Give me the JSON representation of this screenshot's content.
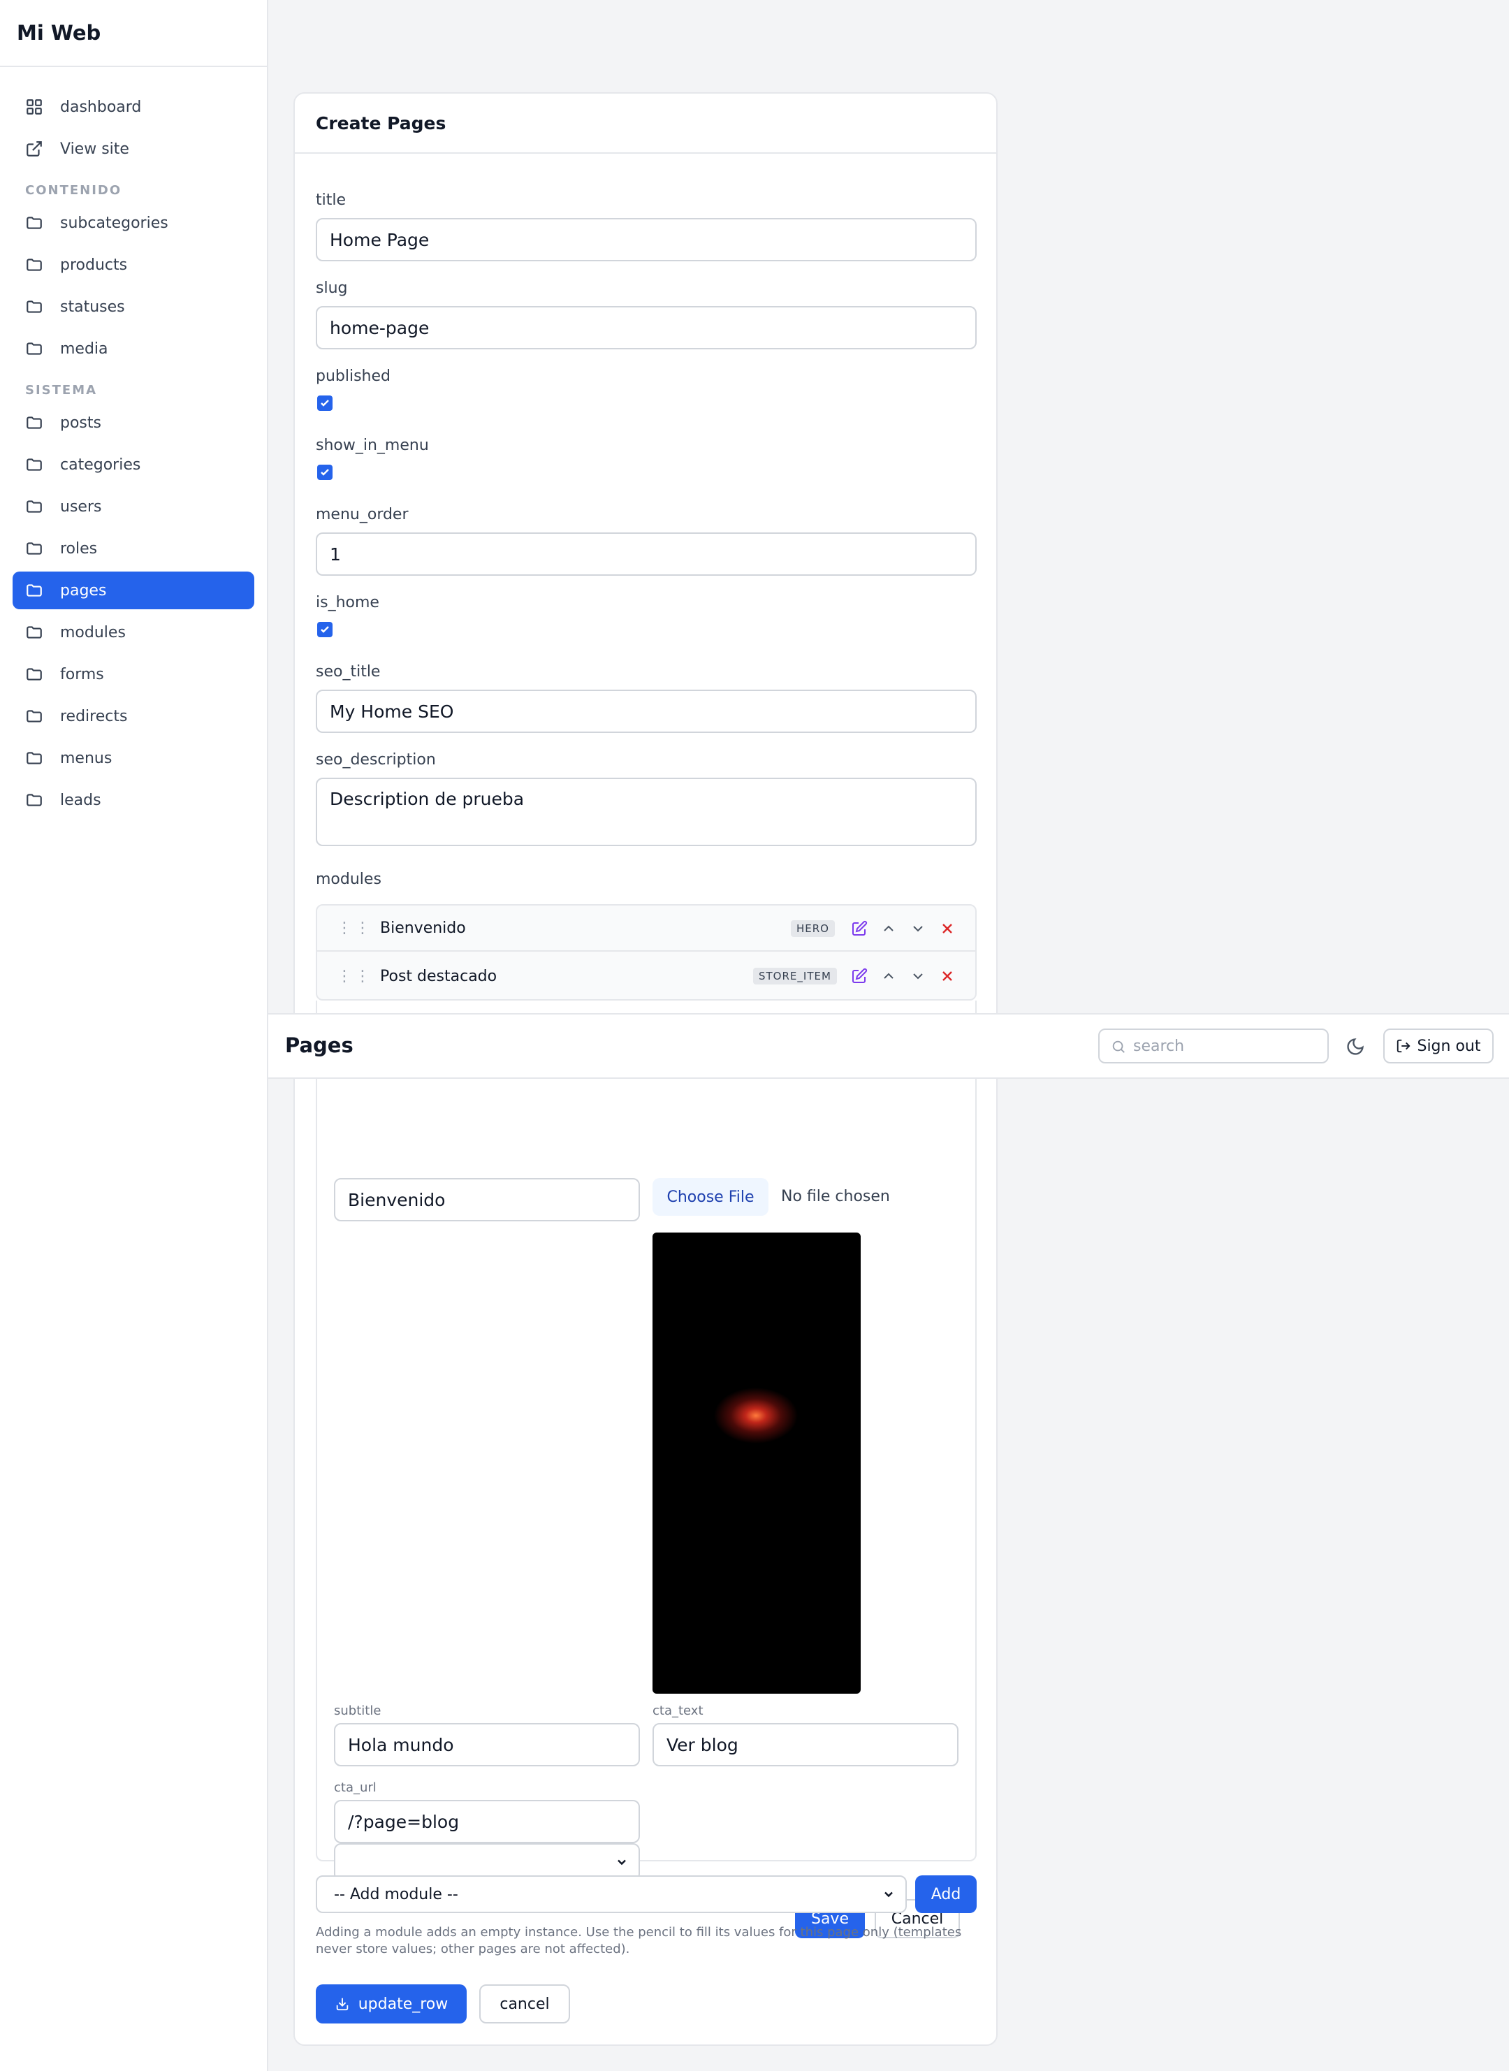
{
  "app": {
    "brand": "Mi Web"
  },
  "sidebar": {
    "top_items": [
      {
        "label": "dashboard",
        "icon": "grid-icon"
      },
      {
        "label": "View site",
        "icon": "external-link-icon"
      }
    ],
    "section_contenido": "CONTENIDO",
    "contenido_items": [
      "subcategories",
      "products",
      "statuses",
      "media"
    ],
    "section_sistema": "SISTEMA",
    "sistema_items": [
      "posts",
      "categories",
      "users",
      "roles",
      "pages",
      "modules",
      "forms",
      "redirects",
      "menus",
      "leads"
    ],
    "active": "pages"
  },
  "header": {
    "title": "Pages",
    "search_placeholder": "search",
    "sign_out": "Sign out"
  },
  "form": {
    "heading": "Create Pages",
    "fields": {
      "title": {
        "label": "title",
        "value": "Home Page"
      },
      "slug": {
        "label": "slug",
        "value": "home-page"
      },
      "published": {
        "label": "published",
        "checked": true
      },
      "show_in_menu": {
        "label": "show_in_menu",
        "checked": true
      },
      "menu_order": {
        "label": "menu_order",
        "value": "1"
      },
      "is_home": {
        "label": "is_home",
        "checked": true
      },
      "seo_title": {
        "label": "seo_title",
        "value": "My Home SEO"
      },
      "seo_description": {
        "label": "seo_description",
        "value": "Description de prueba"
      }
    },
    "modules_label": "modules",
    "modules": [
      {
        "name": "Bienvenido",
        "type": "HERO"
      },
      {
        "name": "Post destacado",
        "type": "STORE_ITEM"
      }
    ],
    "editor": {
      "title_value": "Bienvenido",
      "file_button": "Choose File",
      "file_status": "No file chosen",
      "subtitle_label": "subtitle",
      "subtitle_value": "Hola mundo",
      "cta_text_label": "cta_text",
      "cta_text_value": "Ver blog",
      "cta_url_label": "cta_url",
      "cta_url_value": "/?page=blog",
      "select_value": "",
      "save": "Save",
      "cancel": "Cancel"
    },
    "add_module_select": "-- Add module --",
    "add_button": "Add",
    "help_text_1": "Adding a module adds an empty instance. Use the pencil to fill its values for this page only (templates",
    "help_text_2": "never store values; other pages are not affected).",
    "update_button": "update_row",
    "cancel_button": "cancel"
  },
  "colors": {
    "primary": "#2563eb",
    "danger": "#dc2626",
    "edit": "#7c3aed"
  }
}
